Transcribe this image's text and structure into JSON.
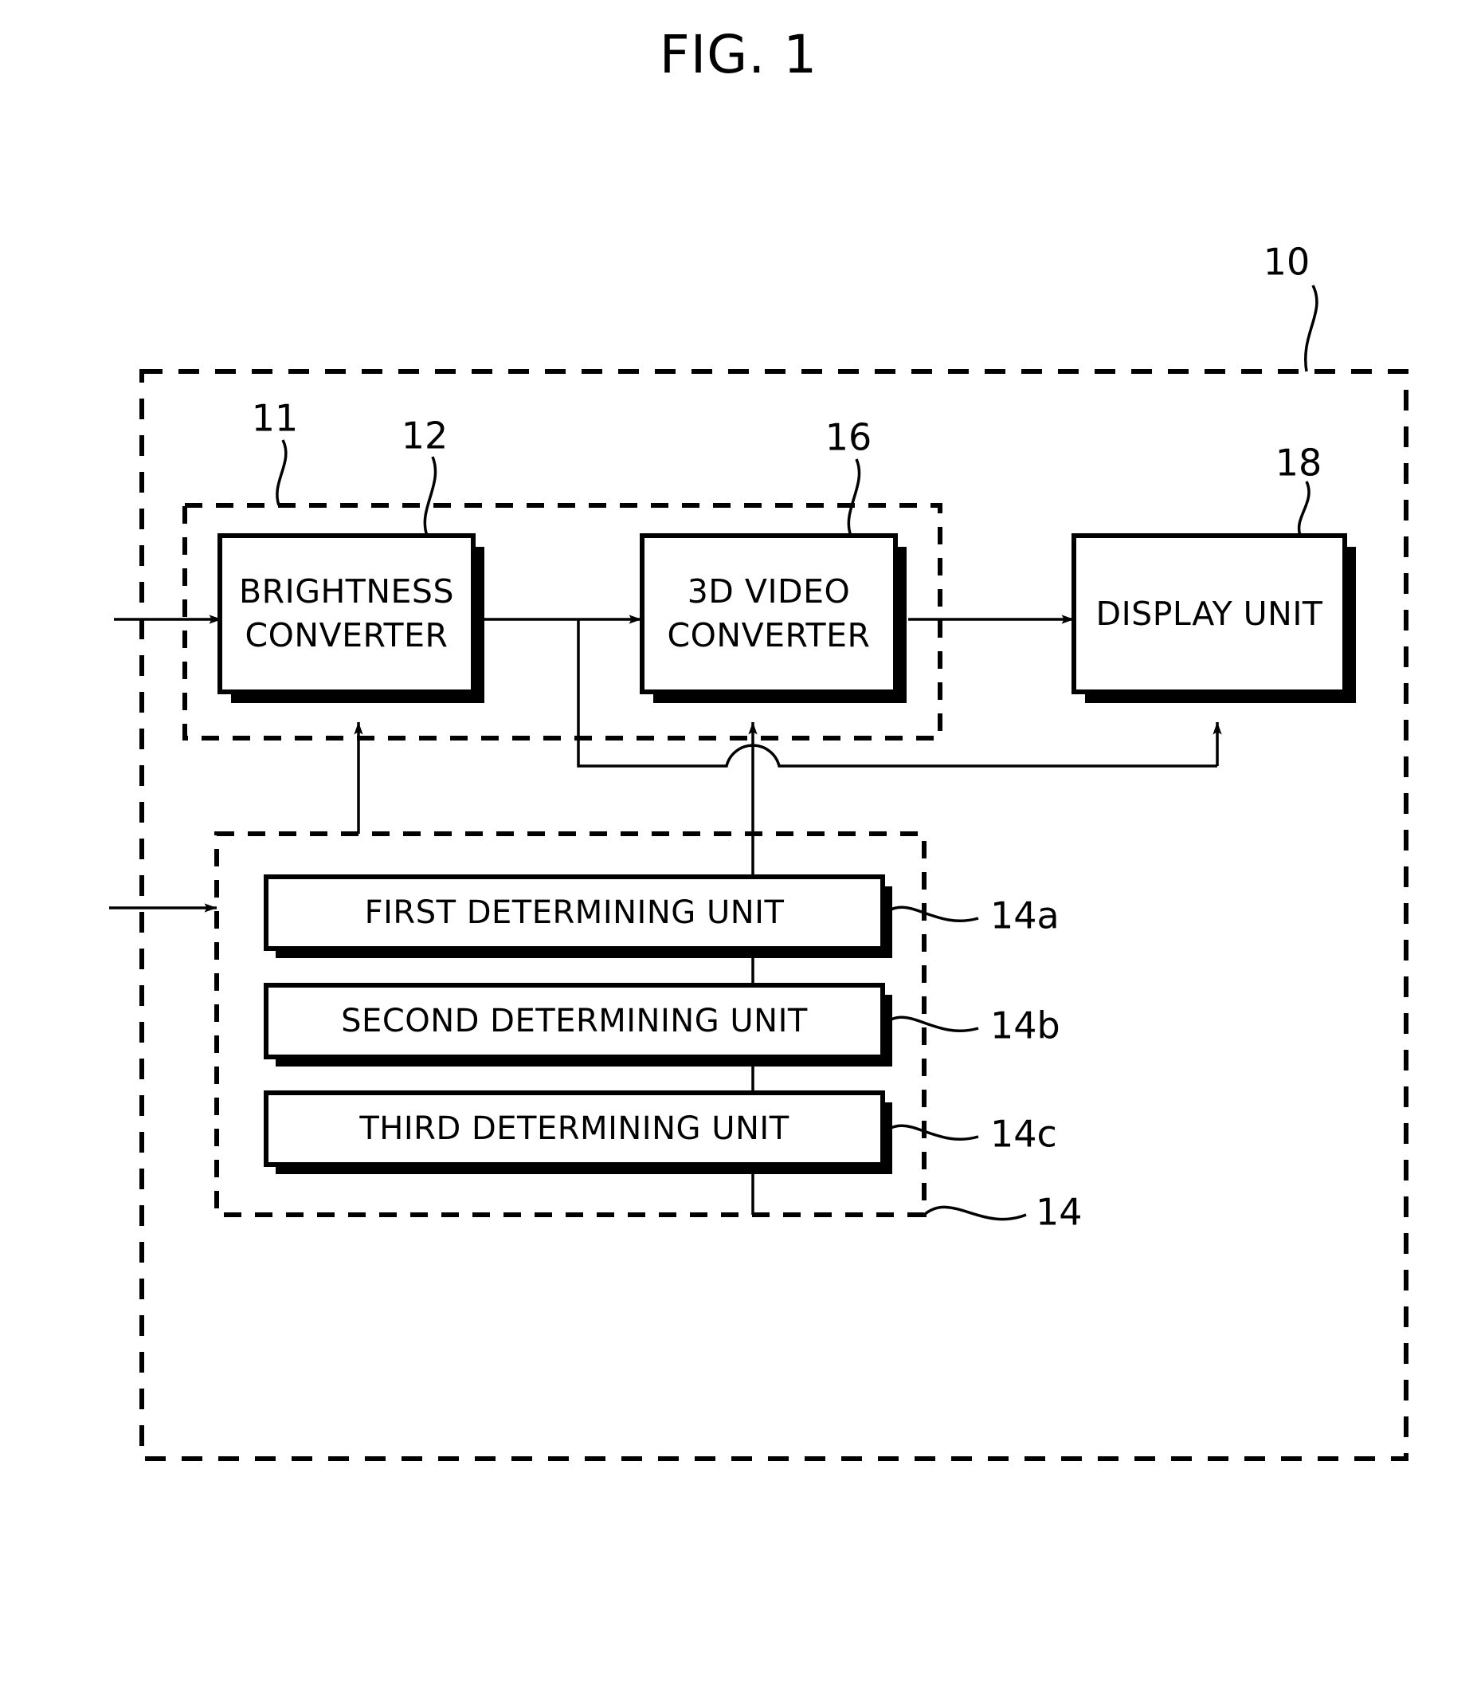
{
  "figure": {
    "title": "FIG. 1"
  },
  "blocks": {
    "brightness_converter": "BRIGHTNESS\nCONVERTER",
    "brightness_converter_line1": "BRIGHTNESS",
    "brightness_converter_line2": "CONVERTER",
    "video_converter_line1": "3D VIDEO",
    "video_converter_line2": "CONVERTER",
    "display_unit": "DISPLAY UNIT",
    "first_determining_unit": "FIRST DETERMINING UNIT",
    "second_determining_unit": "SECOND DETERMINING UNIT",
    "third_determining_unit": "THIRD DETERMINING UNIT"
  },
  "reference_numerals": {
    "apparatus": "10",
    "converter_group": "11",
    "brightness_converter": "12",
    "determining_group": "14",
    "first_determining_unit": "14a",
    "second_determining_unit": "14b",
    "third_determining_unit": "14c",
    "video_converter": "16",
    "display_unit": "18"
  },
  "colors": {
    "ink": "#000000",
    "paper": "#ffffff"
  }
}
